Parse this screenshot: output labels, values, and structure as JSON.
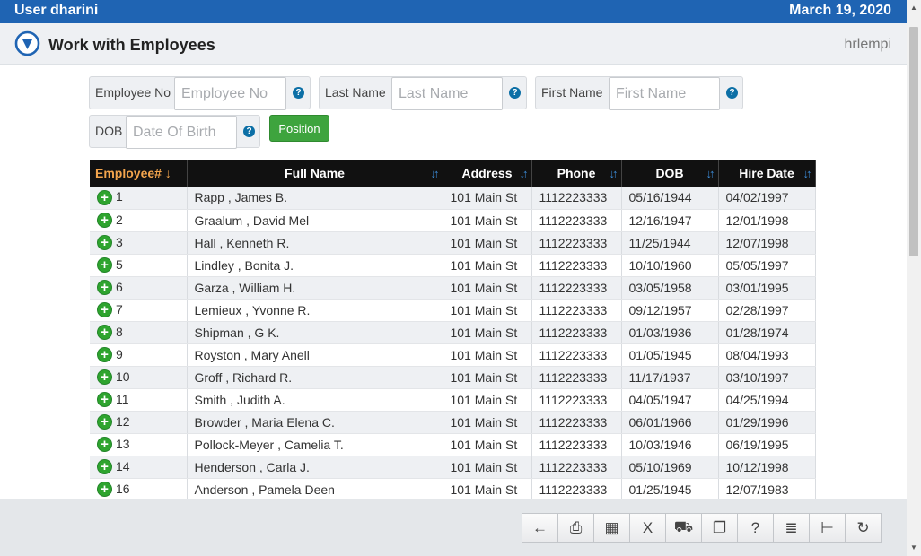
{
  "header": {
    "user": "User dharini",
    "date": "March 19, 2020",
    "title": "Work with Employees",
    "program": "hrlempi"
  },
  "filters": {
    "employee_no": {
      "label": "Employee No",
      "placeholder": "Employee No"
    },
    "last_name": {
      "label": "Last Name",
      "placeholder": "Last Name"
    },
    "first_name": {
      "label": "First Name",
      "placeholder": "First Name"
    },
    "dob": {
      "label": "DOB",
      "placeholder": "Date Of Birth"
    },
    "help_glyph": "?",
    "position_button": "Position"
  },
  "table": {
    "columns": [
      "Employee#",
      "Full Name",
      "Address",
      "Phone",
      "DOB",
      "Hire Date"
    ],
    "sort_glyph_active": "↓",
    "sort_glyph": "↓↑",
    "rows": [
      [
        "1",
        "Rapp , James B.",
        "101 Main St",
        "1112223333",
        "05/16/1944",
        "04/02/1997"
      ],
      [
        "2",
        "Graalum , David Mel",
        "101 Main St",
        "1112223333",
        "12/16/1947",
        "12/01/1998"
      ],
      [
        "3",
        "Hall , Kenneth R.",
        "101 Main St",
        "1112223333",
        "11/25/1944",
        "12/07/1998"
      ],
      [
        "5",
        "Lindley , Bonita J.",
        "101 Main St",
        "1112223333",
        "10/10/1960",
        "05/05/1997"
      ],
      [
        "6",
        "Garza , William H.",
        "101 Main St",
        "1112223333",
        "03/05/1958",
        "03/01/1995"
      ],
      [
        "7",
        "Lemieux , Yvonne R.",
        "101 Main St",
        "1112223333",
        "09/12/1957",
        "02/28/1997"
      ],
      [
        "8",
        "Shipman , G K.",
        "101 Main St",
        "1112223333",
        "01/03/1936",
        "01/28/1974"
      ],
      [
        "9",
        "Royston , Mary Anell",
        "101 Main St",
        "1112223333",
        "01/05/1945",
        "08/04/1993"
      ],
      [
        "10",
        "Groff , Richard R.",
        "101 Main St",
        "1112223333",
        "11/17/1937",
        "03/10/1997"
      ],
      [
        "11",
        "Smith , Judith A.",
        "101 Main St",
        "1112223333",
        "04/05/1947",
        "04/25/1994"
      ],
      [
        "12",
        "Browder , Maria Elena C.",
        "101 Main St",
        "1112223333",
        "06/01/1966",
        "01/29/1996"
      ],
      [
        "13",
        "Pollock-Meyer , Camelia T.",
        "101 Main St",
        "1112223333",
        "10/03/1946",
        "06/19/1995"
      ],
      [
        "14",
        "Henderson , Carla J.",
        "101 Main St",
        "1112223333",
        "05/10/1969",
        "10/12/1998"
      ],
      [
        "16",
        "Anderson , Pamela Deen",
        "101 Main St",
        "1112223333",
        "01/25/1945",
        "12/07/1983"
      ]
    ]
  },
  "toolbar": {
    "buttons": [
      {
        "name": "back-button",
        "icon": "back-arrow-icon",
        "glyph": "←"
      },
      {
        "name": "print-button",
        "icon": "printer-icon",
        "glyph": "⎙"
      },
      {
        "name": "calculator-button",
        "icon": "calculator-icon",
        "glyph": "▦"
      },
      {
        "name": "excel-button",
        "icon": "excel-icon",
        "glyph": "X"
      },
      {
        "name": "automation-button",
        "icon": "truck-clock-icon",
        "glyph": "⛟"
      },
      {
        "name": "copy-button",
        "icon": "layers-icon",
        "glyph": "❐"
      },
      {
        "name": "help-button",
        "icon": "help-icon",
        "glyph": "?"
      },
      {
        "name": "notes-button",
        "icon": "notepad-icon",
        "glyph": "≣"
      },
      {
        "name": "hierarchy-button",
        "icon": "tree-icon",
        "glyph": "⊢"
      },
      {
        "name": "refresh-button",
        "icon": "refresh-icon",
        "glyph": "↻"
      }
    ]
  },
  "colors": {
    "header_bar": "#1f64b3",
    "table_header": "#111111",
    "active_sort": "#f3a54d",
    "add_button": "#2ea42e",
    "position_button": "#3ea43e"
  }
}
